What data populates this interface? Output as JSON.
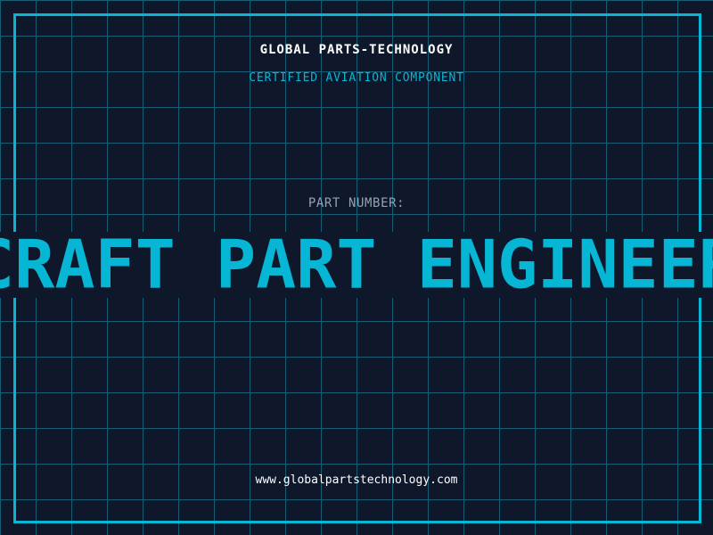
{
  "brand": {
    "name": "GLOBAL PARTS-TECHNOLOGY",
    "tagline": "CERTIFIED AVIATION COMPONENT"
  },
  "part": {
    "label": "PART NUMBER:",
    "value": "AIRCRAFT PART ENGINEERING"
  },
  "footer": {
    "url": "www.globalpartstechnology.com"
  },
  "colors": {
    "background": "#0f172a",
    "accent": "#06b6d4",
    "grid": "#155e75",
    "label": "#94a3b8"
  }
}
